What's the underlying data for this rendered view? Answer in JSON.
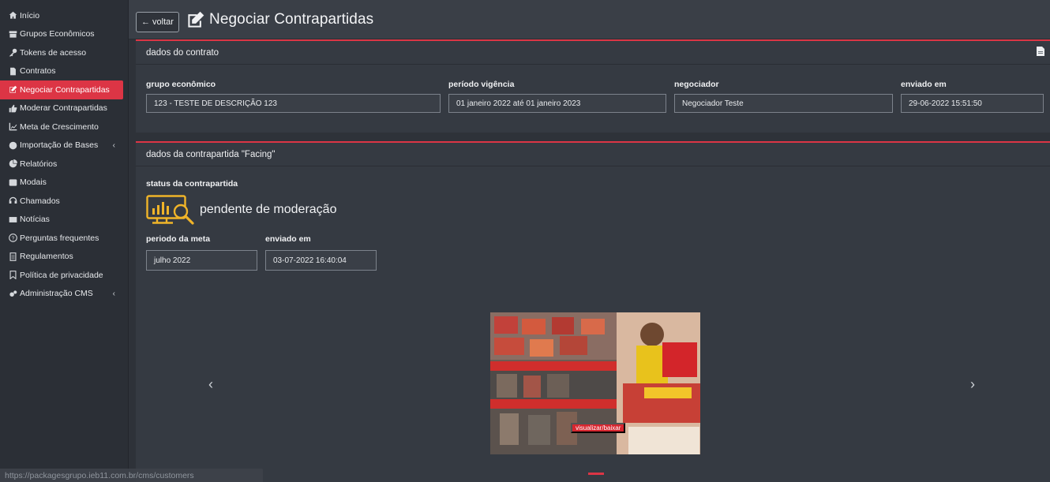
{
  "sidebar": {
    "items": [
      {
        "label": "Início",
        "icon": "home-icon"
      },
      {
        "label": "Grupos Econômicos",
        "icon": "archive-icon"
      },
      {
        "label": "Tokens de acesso",
        "icon": "key-icon"
      },
      {
        "label": "Contratos",
        "icon": "file-icon"
      },
      {
        "label": "Negociar Contrapartidas",
        "icon": "edit-icon",
        "active": true
      },
      {
        "label": "Moderar Contrapartidas",
        "icon": "thumbs-up-icon"
      },
      {
        "label": "Meta de Crescimento",
        "icon": "chart-line-icon"
      },
      {
        "label": "Importação de Bases",
        "icon": "upload-circle-icon",
        "caret": "‹"
      },
      {
        "label": "Relatórios",
        "icon": "pie-chart-icon"
      },
      {
        "label": "Modais",
        "icon": "window-icon"
      },
      {
        "label": "Chamados",
        "icon": "headset-icon"
      },
      {
        "label": "Notícias",
        "icon": "newspaper-icon"
      },
      {
        "label": "Perguntas frequentes",
        "icon": "question-circle-icon"
      },
      {
        "label": "Regulamentos",
        "icon": "document-icon"
      },
      {
        "label": "Política de privacidade",
        "icon": "bookmark-icon"
      },
      {
        "label": "Administração CMS",
        "icon": "cogs-icon",
        "caret": "‹"
      }
    ]
  },
  "header": {
    "back_label": "voltar",
    "title": "Negociar Contrapartidas"
  },
  "contract": {
    "heading": "dados do contrato",
    "fields": {
      "grupo_label": "grupo econômico",
      "grupo_value": "123 - TESTE DE DESCRIÇÃO 123",
      "periodo_label": "período vigência",
      "periodo_value": "01 janeiro 2022 até 01 janeiro 2023",
      "negociador_label": "negociador",
      "negociador_value": "Negociador Teste",
      "enviado_label": "enviado em",
      "enviado_value": "29-06-2022 15:51:50"
    }
  },
  "counterpart": {
    "heading": "dados da contrapartida \"Facing\"",
    "status_label": "status da contrapartida",
    "status_text": "pendente de moderação",
    "periodo_meta_label": "periodo da meta",
    "periodo_meta_value": "julho 2022",
    "enviado_label": "enviado em",
    "enviado_value": "03-07-2022 16:40:04",
    "image_button": "visualizar/baixar"
  },
  "status_bar": {
    "url": "https://packagesgrupo.ieb11.com.br/cms/customers"
  },
  "colors": {
    "accent": "#dc3545",
    "status_icon": "#f0b429"
  }
}
